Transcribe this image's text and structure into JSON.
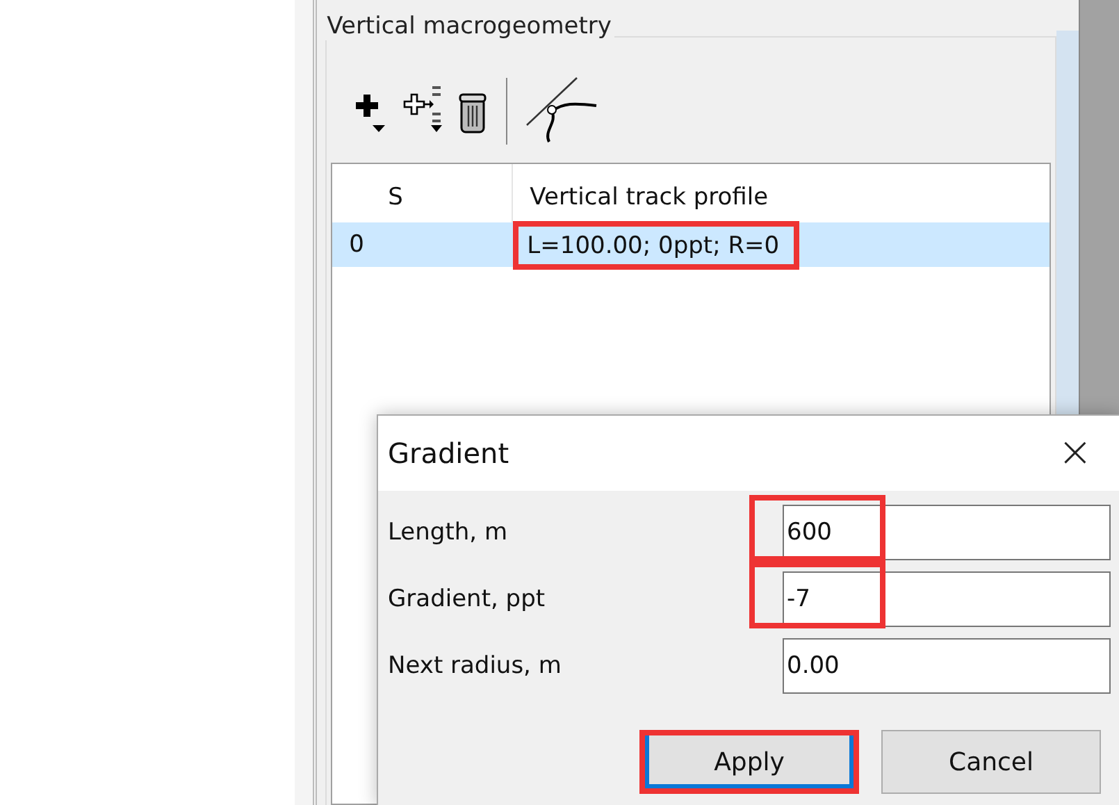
{
  "panel": {
    "group_title": "Vertical macrogeometry",
    "toolbar": [
      {
        "kind": "add",
        "has_menu": true
      },
      {
        "kind": "insert",
        "has_menu": true
      },
      {
        "kind": "delete",
        "has_menu": false
      },
      {
        "kind": "separator"
      },
      {
        "kind": "curve",
        "has_menu": false
      }
    ],
    "table": {
      "columns": [
        "S",
        "Vertical track profile"
      ],
      "rows": [
        {
          "cells": [
            {
              "text": "0",
              "highlighted": false
            },
            {
              "text": "L=100.00; 0ppt; R=0",
              "highlighted": true
            }
          ],
          "selected": true
        }
      ]
    }
  },
  "dialog": {
    "title": "Gradient",
    "close": "×",
    "fields": [
      {
        "label": "Length, m",
        "value": "600",
        "highlighted": true
      },
      {
        "label": "Gradient, ppt",
        "value": "-7",
        "highlighted": true
      },
      {
        "label": "Next radius, m",
        "value": "0.00",
        "highlighted": false
      }
    ],
    "buttons": [
      {
        "label": "Apply",
        "default": true,
        "highlighted": true
      },
      {
        "label": "Cancel",
        "default": false,
        "highlighted": false
      }
    ]
  }
}
